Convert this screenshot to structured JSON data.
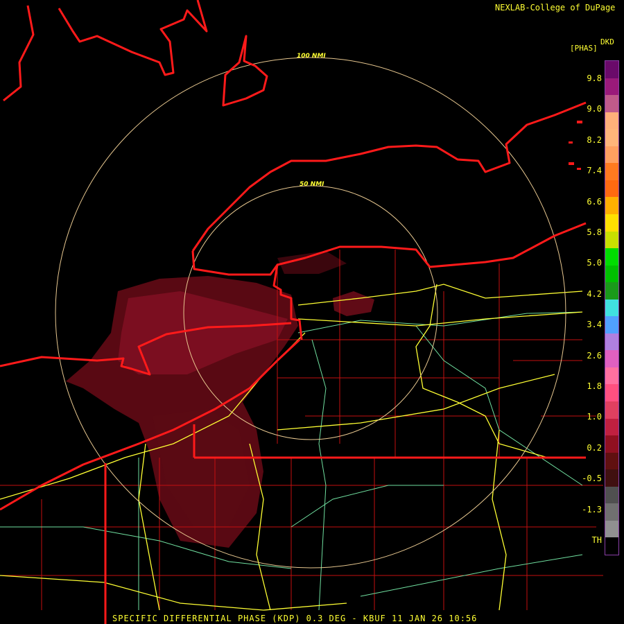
{
  "header": {
    "credit": "NEXLAB-College of DuPage"
  },
  "footer": {
    "caption": "SPECIFIC DIFFERENTIAL PHASE (KDP) 0.3 DEG - KBUF 11 JAN 26 10:56"
  },
  "legend": {
    "product": "DKD",
    "unit": "[PHAS]",
    "labels": [
      "9.8",
      "9.0",
      "8.2",
      "7.4",
      "6.6",
      "5.8",
      "5.0",
      "4.2",
      "3.4",
      "2.6",
      "1.8",
      "1.0",
      "0.2",
      "-0.5",
      "-1.3",
      "TH"
    ],
    "colors": [
      "#6a0a6a",
      "#9a1a7a",
      "#c05a8a",
      "#ffb07a",
      "#ffb57a",
      "#ffa060",
      "#ff7a20",
      "#ff6a10",
      "#ffb000",
      "#ffe000",
      "#c8e000",
      "#00dd00",
      "#00c000",
      "#1a9a1a",
      "#40e0e0",
      "#50a0ff",
      "#b080e0",
      "#e060c0",
      "#ff70a0",
      "#ff5080",
      "#e04060",
      "#c02040",
      "#901020",
      "#601010",
      "#401010",
      "#505050",
      "#707070",
      "#909090",
      "#000000"
    ]
  },
  "map": {
    "range_rings": [
      {
        "label": "50 NMI"
      },
      {
        "label": "100 NMI"
      }
    ],
    "colors": {
      "state_boundary": "#ff1a1a",
      "county_lines": "#c41010",
      "interstate": "#ffff33",
      "highway": "#70e0a0",
      "range_ring": "#e8c890",
      "precip_light": "#6a0a14",
      "precip_moderate": "#8a1020"
    }
  }
}
